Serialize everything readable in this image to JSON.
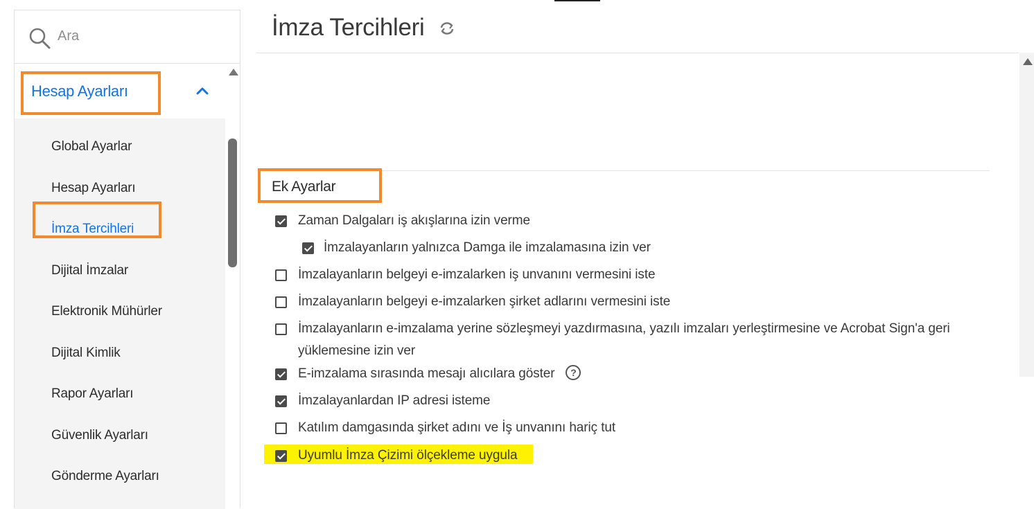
{
  "search": {
    "placeholder": "Ara"
  },
  "sidebar": {
    "section_label": "Hesap Ayarları",
    "items": [
      {
        "label": "Global Ayarlar"
      },
      {
        "label": "Hesap Ayarları"
      },
      {
        "label": "İmza Tercihleri"
      },
      {
        "label": "Dijital İmzalar"
      },
      {
        "label": "Elektronik Mühürler"
      },
      {
        "label": "Dijital Kimlik"
      },
      {
        "label": "Rapor Ayarları"
      },
      {
        "label": "Güvenlik Ayarları"
      },
      {
        "label": "Gönderme Ayarları"
      }
    ],
    "active_item": "İmza Tercihleri"
  },
  "main": {
    "title": "İmza Tercihleri",
    "section_title": "Ek Ayarlar",
    "options": [
      {
        "label": "Zaman Dalgaları iş akışlarına izin verme",
        "checked": true
      },
      {
        "label": "İmzalayanların yalnızca Damga ile imzalamasına izin ver",
        "checked": true
      },
      {
        "label": "İmzalayanların belgeyi e-imzalarken iş unvanını vermesini iste",
        "checked": false
      },
      {
        "label": "İmzalayanların belgeyi e-imzalarken şirket adlarını vermesini iste",
        "checked": false
      },
      {
        "label": "İmzalayanların e-imzalama yerine sözleşmeyi yazdırmasına, yazılı imzaları yerleştirmesine ve Acrobat Sign'a geri yüklemesine izin ver",
        "checked": false
      },
      {
        "label": "E-imzalama sırasında mesajı alıcılara göster",
        "checked": true,
        "help": "?"
      },
      {
        "label": "İmzalayanlardan IP adresi isteme",
        "checked": true
      },
      {
        "label": "Katılım damgasında şirket adını ve İş unvanını hariç tut",
        "checked": false
      },
      {
        "label": "Uyumlu İmza Çizimi ölçekleme uygula",
        "checked": true
      }
    ]
  },
  "colors": {
    "accent": "#1473e6",
    "annotation_box": "#f08a2c",
    "highlight": "#fdf200"
  }
}
